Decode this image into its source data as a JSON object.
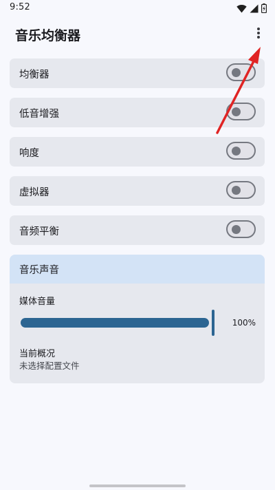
{
  "status_bar": {
    "time": "9:52",
    "icons": [
      "wifi-icon",
      "cellular-signal-icon",
      "battery-icon"
    ]
  },
  "app_bar": {
    "title": "音乐均衡器",
    "more_icon": "more-vert-icon"
  },
  "settings": [
    {
      "label": "均衡器",
      "enabled": false
    },
    {
      "label": "低音增强",
      "enabled": false
    },
    {
      "label": "响度",
      "enabled": false
    },
    {
      "label": "虚拟器",
      "enabled": false
    },
    {
      "label": "音频平衡",
      "enabled": false
    }
  ],
  "sound_card": {
    "title": "音乐声音",
    "volume_label": "媒体音量",
    "volume_value": "100%",
    "volume_level": 1.0,
    "profile_label": "当前概况",
    "profile_value": "未选择配置文件"
  },
  "colors": {
    "background": "#f7f8fd",
    "card": "#e6e8ee",
    "card_header": "#d3e3f6",
    "slider": "#2c6592",
    "toggle_outline": "#757880",
    "annotation_arrow": "#e02424"
  }
}
